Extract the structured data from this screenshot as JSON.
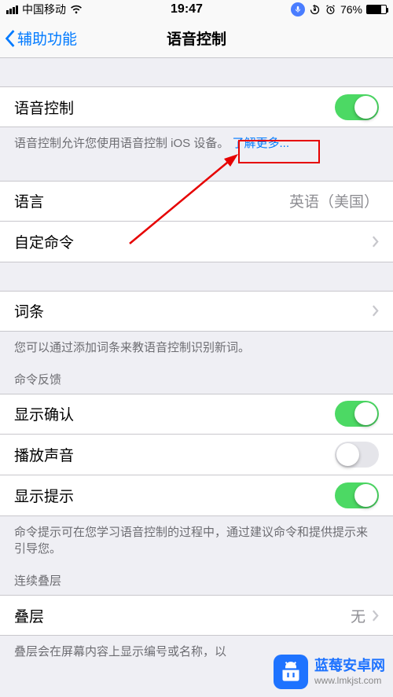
{
  "status": {
    "carrier": "中国移动",
    "time": "19:47",
    "battery_pct": "76%",
    "battery_fill_pct": 76
  },
  "nav": {
    "back_label": "辅助功能",
    "title": "语音控制"
  },
  "main_toggle": {
    "label": "语音控制",
    "on": true,
    "footer_text": "语音控制允许您使用语音控制 iOS 设备。",
    "learn_more": "了解更多..."
  },
  "group2": {
    "language": {
      "label": "语言",
      "value": "英语（美国）"
    },
    "custom": {
      "label": "自定命令"
    }
  },
  "group3": {
    "vocab": {
      "label": "词条"
    },
    "footer": "您可以通过添加词条来教语音控制识别新词。"
  },
  "feedback": {
    "header": "命令反馈",
    "confirm": {
      "label": "显示确认",
      "on": true
    },
    "sound": {
      "label": "播放声音",
      "on": false
    },
    "hints": {
      "label": "显示提示",
      "on": true
    },
    "footer": "命令提示可在您学习语音控制的过程中，通过建议命令和提供提示来引导您。"
  },
  "overlay": {
    "header": "连续叠层",
    "row": {
      "label": "叠层",
      "value": "无"
    },
    "footer": "叠层会在屏幕内容上显示编号或名称，以"
  },
  "watermark": {
    "name": "蓝莓安卓网",
    "url": "www.lmkjst.com"
  }
}
